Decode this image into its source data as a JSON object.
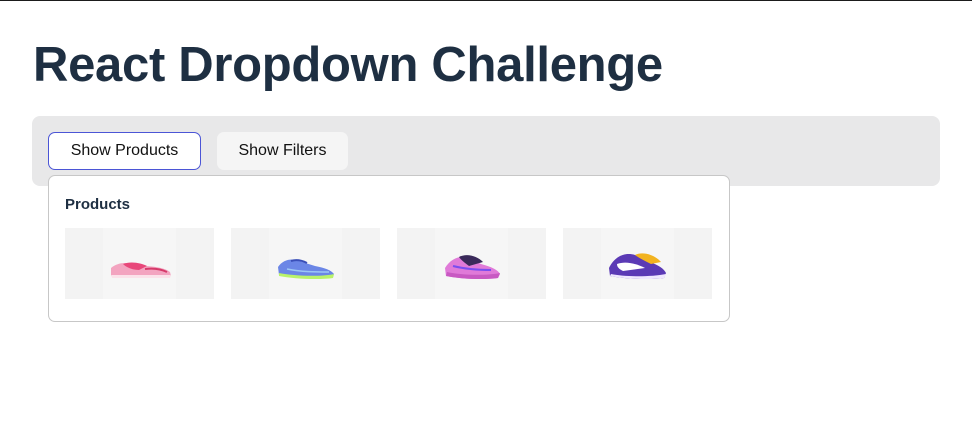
{
  "page": {
    "title": "React Dropdown Challenge"
  },
  "toolbar": {
    "show_products_label": "Show Products",
    "show_filters_label": "Show Filters"
  },
  "dropdown": {
    "title": "Products",
    "products": [
      {
        "icon": "pink-sneaker-image",
        "color": "#e8477a",
        "accent": "#f6a9c3"
      },
      {
        "icon": "blue-running-shoe-image",
        "color": "#6b86e6",
        "accent": "#b9f36a"
      },
      {
        "icon": "purple-basketball-shoe-image",
        "color": "#e07ad8",
        "accent": "#7a4df0"
      },
      {
        "icon": "purple-gold-basketball-shoe-image",
        "color": "#5b3ab5",
        "accent": "#f2b320"
      }
    ]
  }
}
